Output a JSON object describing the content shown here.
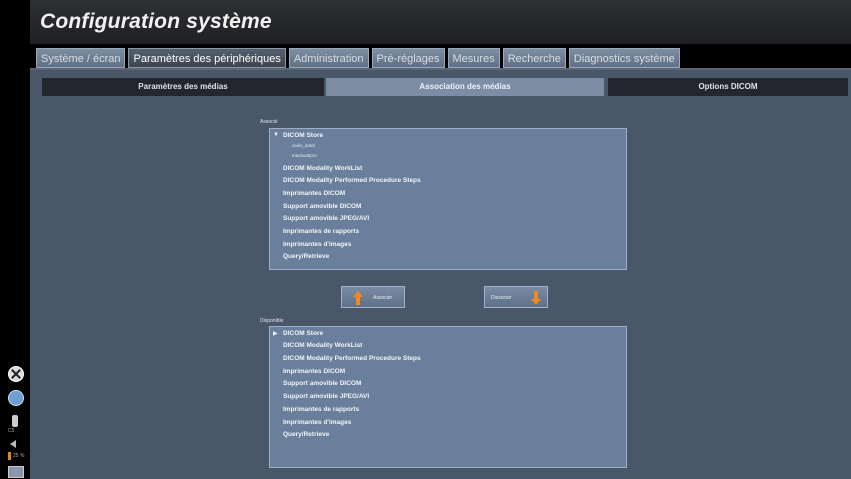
{
  "app": {
    "title": "Configuration système"
  },
  "tabs": [
    {
      "label": "Système / écran",
      "active": false
    },
    {
      "label": "Paramètres des périphériques",
      "active": true
    },
    {
      "label": "Administration",
      "active": false
    },
    {
      "label": "Pré-réglages",
      "active": false
    },
    {
      "label": "Mesures",
      "active": false
    },
    {
      "label": "Recherche",
      "active": false
    },
    {
      "label": "Diagnostics système",
      "active": false
    }
  ],
  "subtabs": [
    {
      "label": "Paramètres des médias",
      "active": false
    },
    {
      "label": "Association des médias",
      "active": true
    },
    {
      "label": "Options DICOM",
      "active": false
    }
  ],
  "associated": {
    "label": "Associé",
    "group": {
      "label": "DICOM Store",
      "expanded": true,
      "children": [
        "cairis_antal",
        "macbookpro"
      ]
    },
    "items": [
      "DICOM Modality WorkList",
      "DICOM Modality Performed Procedure Steps",
      "Imprimantes DICOM",
      "Support amovible DICOM",
      "Support amovible JPEG/AVI",
      "Imprimantes de rapports",
      "Imprimantes d'images",
      "Query/Retrieve"
    ]
  },
  "available": {
    "label": "Disponible",
    "group": {
      "label": "DICOM Store",
      "expanded": false
    },
    "items": [
      "DICOM Modality WorkList",
      "DICOM Modality Performed Procedure Steps",
      "Imprimantes DICOM",
      "Support amovible DICOM",
      "Support amovible JPEG/AVI",
      "Imprimantes de rapports",
      "Imprimantes d'images",
      "Query/Retrieve"
    ]
  },
  "buttons": {
    "associate": "Associer",
    "dissociate": "Dissocier"
  },
  "left_strip": {
    "icons": [
      "close-circle-icon",
      "globe-icon",
      "probe-icon",
      "volume-icon",
      "bars-icon",
      "screen-icon"
    ],
    "probe_label": "C5",
    "bars_label": "25 %"
  },
  "colors": {
    "content_bg": "#4a5768",
    "list_bg": "#6a7f9b",
    "accent_arrow": "#f08a1c"
  }
}
